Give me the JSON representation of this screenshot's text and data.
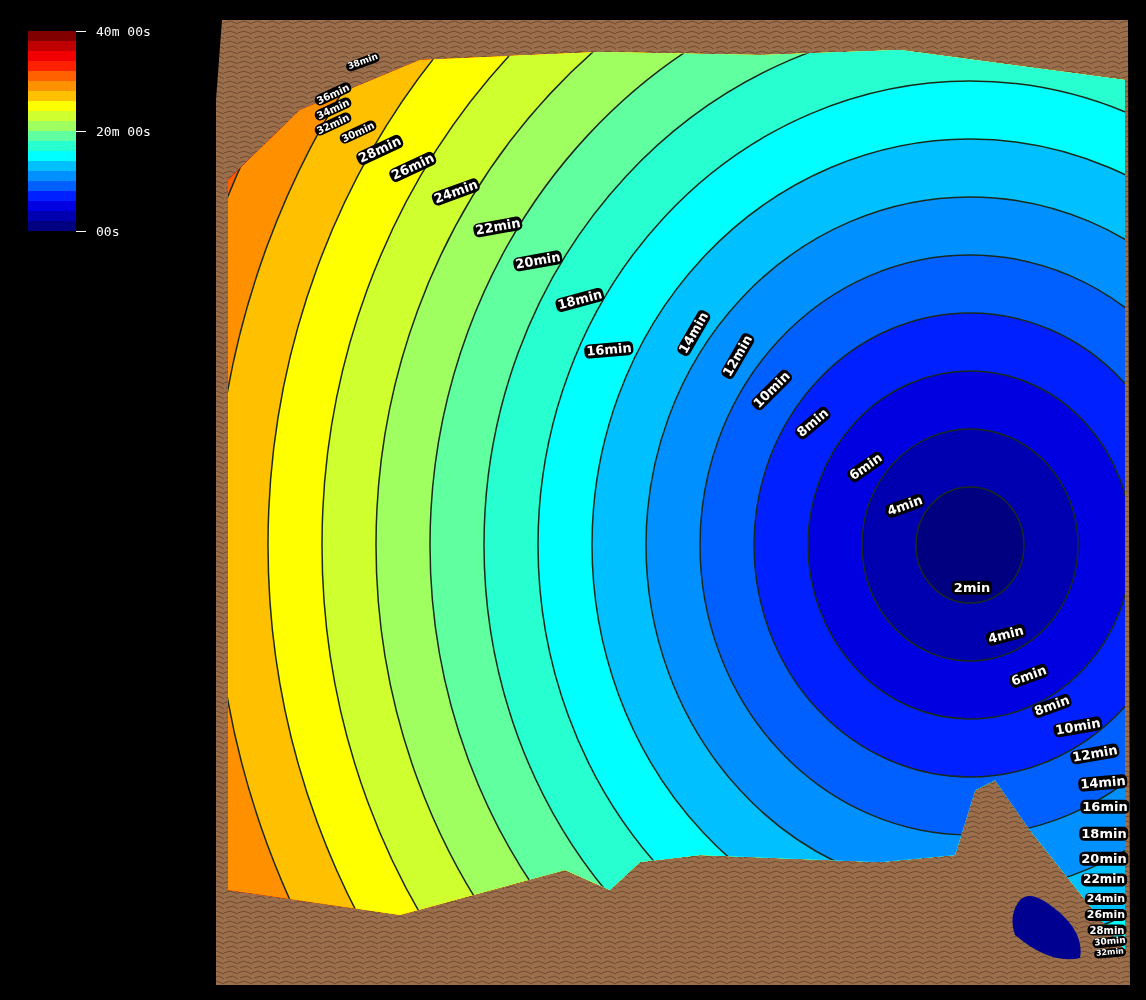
{
  "legend": {
    "ticks": [
      "40m 00s",
      "20m 00s",
      "00s"
    ],
    "bands": [
      {
        "color": "#800000"
      },
      {
        "color": "#c00000"
      },
      {
        "color": "#f00000"
      },
      {
        "color": "#ff2000"
      },
      {
        "color": "#ff6000"
      },
      {
        "color": "#ff9000"
      },
      {
        "color": "#ffc000"
      },
      {
        "color": "#ffff00"
      },
      {
        "color": "#d0ff30"
      },
      {
        "color": "#a0ff60"
      },
      {
        "color": "#60ffa0"
      },
      {
        "color": "#28ffd0"
      },
      {
        "color": "#00ffff"
      },
      {
        "color": "#00c0ff"
      },
      {
        "color": "#0090ff"
      },
      {
        "color": "#0060ff"
      },
      {
        "color": "#0020ff"
      },
      {
        "color": "#0000e0"
      },
      {
        "color": "#0000b0"
      },
      {
        "color": "#000080"
      }
    ]
  },
  "contour_labels": [
    "38min",
    "36min",
    "34min",
    "32min",
    "30min",
    "28min",
    "26min",
    "24min",
    "22min",
    "20min",
    "18min",
    "16min",
    "14min",
    "12min",
    "10min",
    "8min",
    "6min",
    "4min",
    "2min",
    "4min",
    "6min",
    "8min",
    "10min",
    "12min",
    "14min",
    "16min",
    "18min",
    "20min",
    "22min",
    "24min",
    "26min",
    "28min",
    "30min",
    "32min"
  ]
}
